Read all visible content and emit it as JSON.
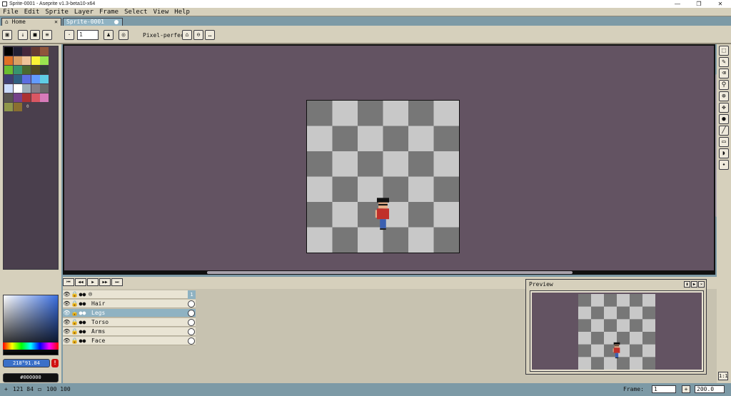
{
  "window": {
    "title": "Sprite-0001 - Aseprite v1.3-beta10-x64",
    "minimize": "—",
    "maximize": "❐",
    "close": "✕"
  },
  "menu": [
    "File",
    "Edit",
    "Sprite",
    "Layer",
    "Frame",
    "Select",
    "View",
    "Help"
  ],
  "tabs": {
    "home": "Home",
    "home_close": "✕",
    "sprite": "Sprite-0001"
  },
  "toolbar": {
    "zoom_value": "1",
    "pixel_perfect": "Pixel-perfect"
  },
  "palette": {
    "colors": [
      "#000000",
      "#222034",
      "#45283c",
      "#663931",
      "#8f563b",
      "#df7126",
      "#d9a066",
      "#eec39a",
      "#fbf236",
      "#99e550",
      "#6abe30",
      "#37946e",
      "#4b692f",
      "#524b24",
      "#323c39",
      "#3f3f74",
      "#306082",
      "#5b6ee1",
      "#639bff",
      "#5fcde4",
      "#cbdbfc",
      "#ffffff",
      "#9badb7",
      "#847e87",
      "#696a6a",
      "#595652",
      "#76428a",
      "#ac3232",
      "#d95763",
      "#d77bba",
      "#8f974a",
      "#8a6f30"
    ],
    "count": "0"
  },
  "colorbar": {
    "fg_value": "218°91.84",
    "bg_value": "#000000",
    "warning": "!"
  },
  "timeline": {
    "controls": [
      "⏮",
      "◀◀",
      "▶",
      "▶▶",
      "⏭"
    ],
    "frame_number": "1",
    "layers": [
      {
        "name": "Hair",
        "selected": false
      },
      {
        "name": "Legs",
        "selected": true
      },
      {
        "name": "Torso",
        "selected": false
      },
      {
        "name": "Arms",
        "selected": false
      },
      {
        "name": "Face",
        "selected": false
      }
    ]
  },
  "preview": {
    "title": "Preview"
  },
  "status": {
    "coords": "121 84",
    "size": "100 100",
    "frame_label": "Frame:",
    "frame_value": "1",
    "frame_plus": "+",
    "duration": "200.0",
    "one_to_one": "1:1"
  },
  "colors": {
    "accent": "#8fb2c2",
    "panel": "#d6d0bc",
    "canvas_bg": "#635362",
    "checker_dark": "#777777",
    "checker_light": "#c8c8c8"
  }
}
